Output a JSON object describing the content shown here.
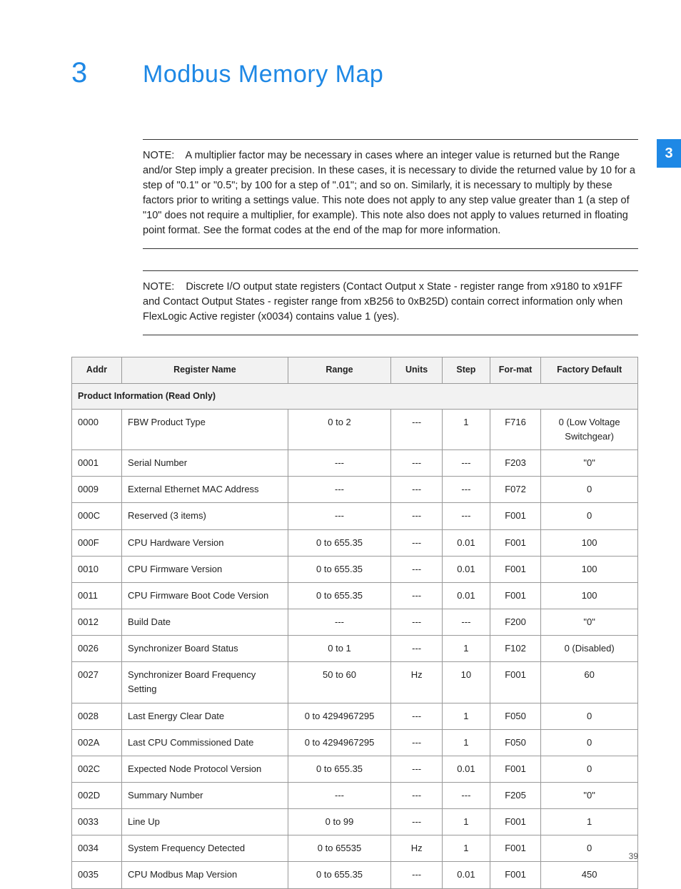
{
  "chapter": {
    "number": "3",
    "title": "Modbus Memory Map"
  },
  "side_tab": "3",
  "page_number": "39",
  "notes": [
    {
      "label": "NOTE:",
      "text": "A multiplier factor may be necessary in cases where an integer value is returned but the Range and/or Step imply a greater precision. In these cases, it is necessary to divide the returned value by 10 for a step of \"0.1\" or \"0.5\"; by 100 for a step of \".01\"; and so on. Similarly, it is necessary to multiply by these factors prior to writing a settings value. This note does not apply to any step value greater than 1 (a step of \"10\" does not require a multiplier, for example). This note also does not apply to values returned in floating point format. See the format codes at the end of the map for more information."
    },
    {
      "label": "NOTE:",
      "text": "Discrete I/O output state registers (Contact Output x State - register range from x9180 to x91FF and Contact Output States - register range from xB256 to 0xB25D) contain correct information only when FlexLogic Active register (x0034) contains value 1 (yes)."
    }
  ],
  "table": {
    "headers": {
      "addr": "Addr",
      "name": "Register Name",
      "range": "Range",
      "units": "Units",
      "step": "Step",
      "format": "For-mat",
      "default": "Factory Default"
    },
    "section": "Product Information (Read Only)",
    "rows": [
      {
        "addr": "0000",
        "name": "FBW Product Type",
        "range": "0 to 2",
        "units": "---",
        "step": "1",
        "format": "F716",
        "default": "0 (Low Voltage Switchgear)"
      },
      {
        "addr": "0001",
        "name": "Serial Number",
        "range": "---",
        "units": "---",
        "step": "---",
        "format": "F203",
        "default": "\"0\""
      },
      {
        "addr": "0009",
        "name": "External Ethernet MAC Address",
        "range": "---",
        "units": "---",
        "step": "---",
        "format": "F072",
        "default": "0"
      },
      {
        "addr": "000C",
        "name": "Reserved (3 items)",
        "range": "---",
        "units": "---",
        "step": "---",
        "format": "F001",
        "default": "0"
      },
      {
        "addr": "000F",
        "name": "CPU Hardware Version",
        "range": "0 to 655.35",
        "units": "---",
        "step": "0.01",
        "format": "F001",
        "default": "100"
      },
      {
        "addr": "0010",
        "name": "CPU Firmware Version",
        "range": "0 to 655.35",
        "units": "---",
        "step": "0.01",
        "format": "F001",
        "default": "100"
      },
      {
        "addr": "0011",
        "name": "CPU Firmware Boot Code Version",
        "range": "0 to 655.35",
        "units": "---",
        "step": "0.01",
        "format": "F001",
        "default": "100"
      },
      {
        "addr": "0012",
        "name": "Build Date",
        "range": "---",
        "units": "---",
        "step": "---",
        "format": "F200",
        "default": "\"0\""
      },
      {
        "addr": "0026",
        "name": "Synchronizer Board Status",
        "range": "0 to 1",
        "units": "---",
        "step": "1",
        "format": "F102",
        "default": "0 (Disabled)"
      },
      {
        "addr": "0027",
        "name": "Synchronizer Board Frequency Setting",
        "range": "50 to 60",
        "units": "Hz",
        "step": "10",
        "format": "F001",
        "default": "60"
      },
      {
        "addr": "0028",
        "name": "Last Energy Clear Date",
        "range": "0 to 4294967295",
        "units": "---",
        "step": "1",
        "format": "F050",
        "default": "0"
      },
      {
        "addr": "002A",
        "name": "Last CPU Commissioned Date",
        "range": "0 to 4294967295",
        "units": "---",
        "step": "1",
        "format": "F050",
        "default": "0"
      },
      {
        "addr": "002C",
        "name": "Expected Node Protocol Version",
        "range": "0 to 655.35",
        "units": "---",
        "step": "0.01",
        "format": "F001",
        "default": "0"
      },
      {
        "addr": "002D",
        "name": "Summary Number",
        "range": "---",
        "units": "---",
        "step": "---",
        "format": "F205",
        "default": "\"0\""
      },
      {
        "addr": "0033",
        "name": "Line Up",
        "range": "0 to 99",
        "units": "---",
        "step": "1",
        "format": "F001",
        "default": "1"
      },
      {
        "addr": "0034",
        "name": "System Frequency Detected",
        "range": "0 to 65535",
        "units": "Hz",
        "step": "1",
        "format": "F001",
        "default": "0"
      },
      {
        "addr": "0035",
        "name": "CPU Modbus Map Version",
        "range": "0 to 655.35",
        "units": "---",
        "step": "0.01",
        "format": "F001",
        "default": "450"
      }
    ]
  }
}
